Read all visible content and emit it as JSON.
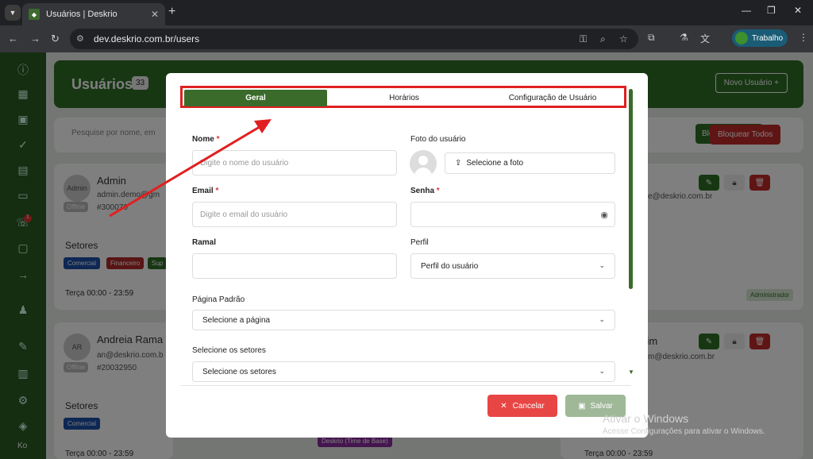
{
  "browser": {
    "tab_title": "Usuários | Deskrio",
    "url": "dev.deskrio.com.br/users",
    "profile_name": "Trabalho"
  },
  "background": {
    "header_title": "Usuários",
    "user_count": "33",
    "new_user_label": "Novo Usuário +",
    "search_placeholder": "Pesquise por nome, em",
    "block_all_label": "Bloquear Todos",
    "unblock_all_label": "Bloquear Todos",
    "users": [
      {
        "name": "Admin",
        "email": "admin.demo@gm",
        "id": "#300070",
        "status": "Offline",
        "avatar_text": "Admin",
        "email_right": "e@deskrio.com.br"
      },
      {
        "name": "Andreia Rama",
        "email": "an@deskrio.com.b",
        "id": "#20032950",
        "status": "Offline",
        "avatar_text": "AR",
        "name_right": "vim",
        "email_right": "m@deskrio.com.br"
      }
    ],
    "sectors_label": "Setores",
    "chips": [
      "Comercial",
      "Financeiro",
      "Sup"
    ],
    "chip2": "Comercial",
    "hours": "Terça 00:00 - 23:59",
    "admin_badge": "Administrador",
    "sidebar_bottom": "Ko",
    "chip_purple": "Deskrio (Time de Base)"
  },
  "modal": {
    "tabs": [
      {
        "label": "Geral",
        "active": true
      },
      {
        "label": "Horários",
        "active": false
      },
      {
        "label": "Configuração de Usuário",
        "active": false
      }
    ],
    "name_label": "Nome",
    "name_placeholder": "Digite o nome do usuário",
    "photo_label": "Foto do usuário",
    "photo_button": "Selecione a foto",
    "email_label": "Email",
    "email_placeholder": "Digite o email do usuário",
    "password_label": "Senha",
    "extension_label": "Ramal",
    "profile_label": "Perfil",
    "profile_value": "Perfil do usuário",
    "default_page_label": "Página Padrão",
    "default_page_value": "Selecione a página",
    "sectors_label": "Selecione os setores",
    "sectors_value": "Selecione os setores",
    "cancel_label": "Cancelar",
    "save_label": "Salvar"
  },
  "watermark": {
    "line1": "Ativar o Windows",
    "line2": "Acesse Configurações para ativar o Windows."
  },
  "colors": {
    "brand_green": "#3a6b2a",
    "annotation_red": "#e02020",
    "cancel_red": "#e84545",
    "save_disabled": "#9fb897"
  }
}
